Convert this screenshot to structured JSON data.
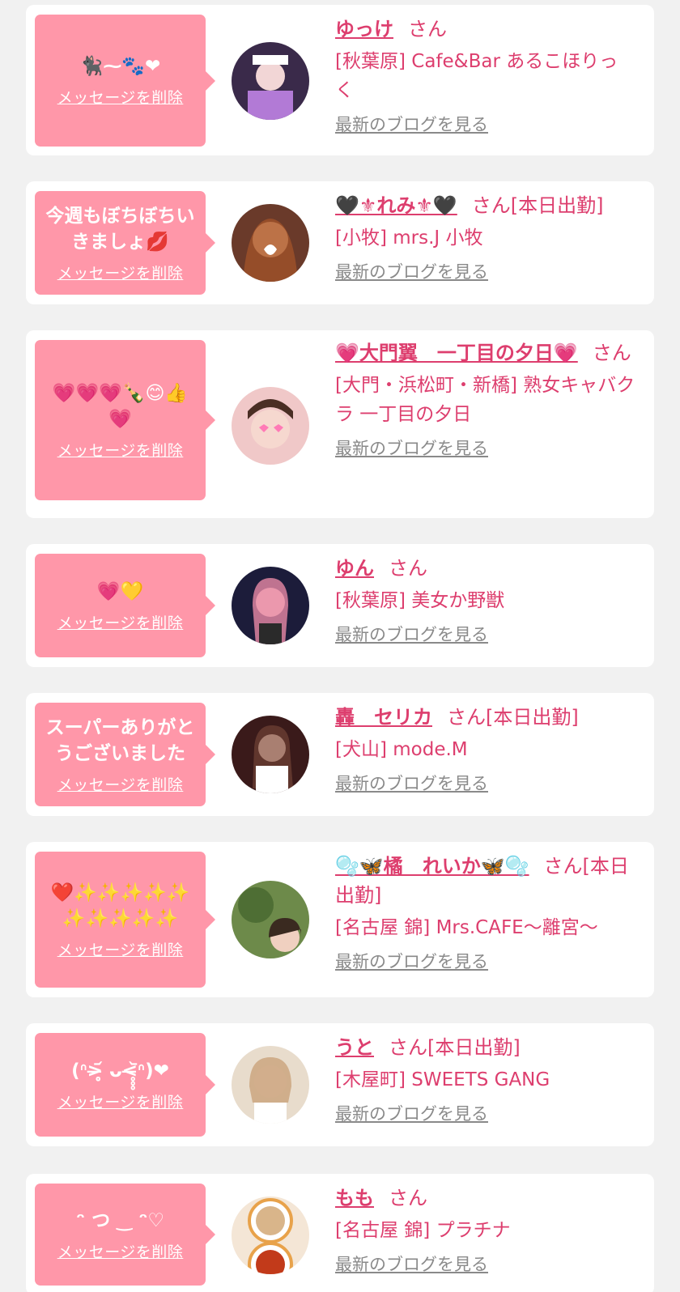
{
  "delete_label": "メッセージを削除",
  "san_label": "さん",
  "blog_label": "最新のブログを見る",
  "cards": [
    {
      "name": "ゆっけ",
      "status": "",
      "shop": "[秋葉原] Cafe&Bar あるこほりっく",
      "message": "🐈‍⬛⁓🐾❤",
      "avatar_icon": "avatar-photo"
    },
    {
      "name": "🖤⚜れみ⚜🖤",
      "status": "[本日出勤]",
      "shop": "[小牧] mrs.J 小牧",
      "message": "今週もぼちぼちいきましょ💋",
      "avatar_icon": "avatar-photo"
    },
    {
      "name": "💗大門翼　一丁目の夕日💗",
      "status": "",
      "shop": "[大門・浜松町・新橋] 熟女キャバクラ 一丁目の夕日",
      "message": "💗💗💗🍾😊👍💗",
      "avatar_icon": "avatar-photo"
    },
    {
      "name": "ゆん",
      "status": "",
      "shop": "[秋葉原] 美女か野獣",
      "message": "💗💛",
      "avatar_icon": "avatar-photo"
    },
    {
      "name": "轟　セリカ",
      "status": "[本日出勤]",
      "shop": "[犬山] mode.M",
      "message": "スーパーありがとうございました",
      "avatar_icon": "avatar-photo"
    },
    {
      "name": "🫧🦋橘　れいか🦋🫧",
      "status": "[本日出勤]",
      "shop": "[名古屋 錦] Mrs.CAFE〜離宮〜",
      "message": "❤️✨✨✨✨✨✨✨✨✨✨",
      "avatar_icon": "avatar-photo"
    },
    {
      "name": "うと",
      "status": "[本日出勤]",
      "shop": "[木屋町] SWEETS GANG",
      "message": "(ᐢ>̶̥̥̥᷄ ᴗ<̶̥̥̥᷅ᐢ)❤",
      "avatar_icon": "avatar-photo"
    },
    {
      "name": "もも",
      "status": "",
      "shop": "[名古屋 錦] プラチナ",
      "message": "ᵔ つ ‿ ᵔ♡",
      "avatar_icon": "avatar-photo"
    }
  ]
}
